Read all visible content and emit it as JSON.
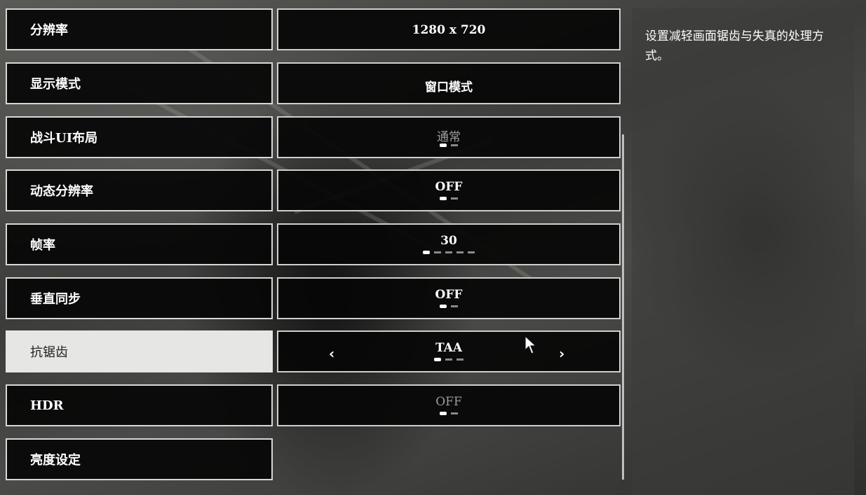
{
  "settings": [
    {
      "label": "分辨率",
      "value": "1280 x 720",
      "dim": false,
      "dots": 0,
      "active_dot": 0
    },
    {
      "label": "显示模式",
      "value": "窗口模式",
      "dim": false,
      "dots": 0,
      "active_dot": 0
    },
    {
      "label": "战斗UI布局",
      "value": "通常",
      "dim": true,
      "dots": 2,
      "active_dot": 0
    },
    {
      "label": "动态分辨率",
      "value": "OFF",
      "dim": false,
      "dots": 2,
      "active_dot": 0
    },
    {
      "label": "帧率",
      "value": "30",
      "dim": false,
      "dots": 5,
      "active_dot": 0
    },
    {
      "label": "垂直同步",
      "value": "OFF",
      "dim": false,
      "dots": 2,
      "active_dot": 0
    },
    {
      "label": "抗锯齿",
      "value": "TAA",
      "dim": false,
      "dots": 3,
      "active_dot": 0
    },
    {
      "label": "HDR",
      "value": "OFF",
      "dim": true,
      "dots": 2,
      "active_dot": 0
    },
    {
      "label": "亮度设定"
    }
  ],
  "selected_index": 6,
  "arrows": {
    "left": "‹",
    "right": "›"
  },
  "description": "设置减轻画面锯齿与失真的处理方式。",
  "icons": {
    "cursor": "mouse-cursor-icon",
    "left": "chevron-left-icon",
    "right": "chevron-right-icon"
  }
}
